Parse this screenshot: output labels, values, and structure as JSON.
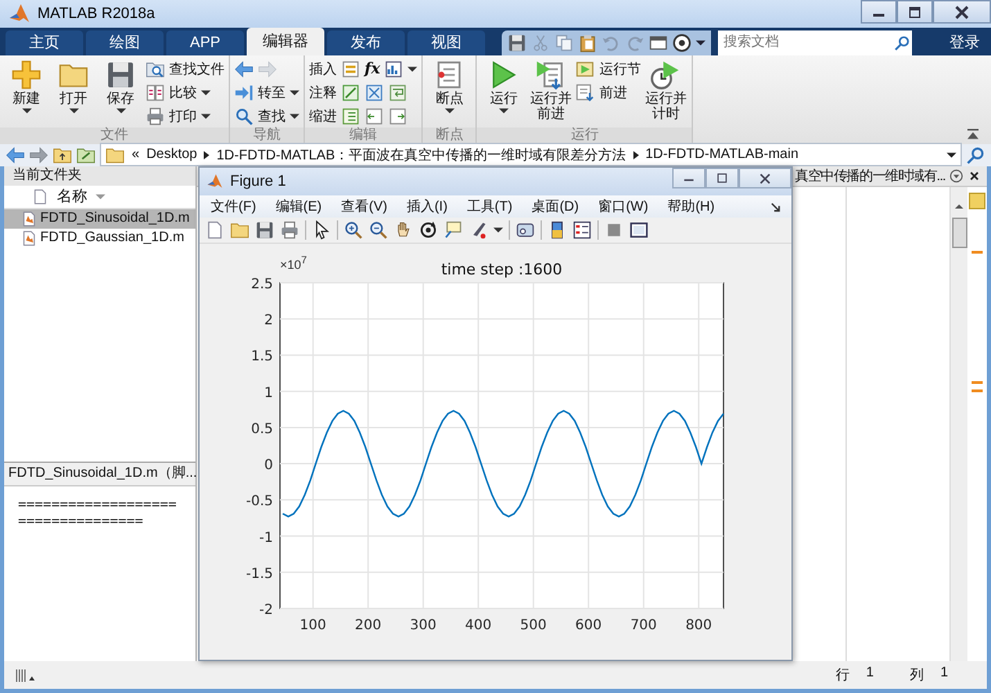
{
  "window": {
    "title": "MATLAB R2018a"
  },
  "tabs": [
    {
      "label": "主页",
      "selected": false
    },
    {
      "label": "绘图",
      "selected": false
    },
    {
      "label": "APP",
      "selected": false
    },
    {
      "label": "编辑器",
      "selected": true
    },
    {
      "label": "发布",
      "selected": false
    },
    {
      "label": "视图",
      "selected": false
    }
  ],
  "search": {
    "placeholder": "搜索文档"
  },
  "login": "登录",
  "ribbon": {
    "groups": [
      {
        "title": "文件",
        "columns": [
          {
            "kind": "large",
            "label": "新建",
            "dropdown": true
          },
          {
            "kind": "large",
            "label": "打开",
            "dropdown": true
          },
          {
            "kind": "large",
            "label": "保存",
            "dropdown": true
          },
          {
            "kind": "stack",
            "items": [
              {
                "kind": "button",
                "label": "查找文件",
                "dropdown": false
              },
              {
                "kind": "button",
                "label": "比较",
                "dropdown": true
              },
              {
                "kind": "button",
                "label": "打印",
                "dropdown": true
              }
            ]
          }
        ]
      },
      {
        "title": "导航",
        "columns": [
          {
            "kind": "stack",
            "items": [
              {
                "kind": "arrows"
              },
              {
                "kind": "button",
                "label": "转至",
                "dropdown": true
              },
              {
                "kind": "button",
                "label": "查找",
                "dropdown": true
              }
            ]
          }
        ]
      },
      {
        "title": "编辑",
        "columns": [
          {
            "kind": "stack",
            "items": [
              {
                "kind": "tools",
                "label": "插入",
                "glyph": "fx",
                "dropdown": true
              },
              {
                "kind": "tools",
                "label": "注释",
                "dropdown": false
              },
              {
                "kind": "tools",
                "label": "缩进",
                "dropdown": false
              }
            ]
          }
        ]
      },
      {
        "title": "断点",
        "columns": [
          {
            "kind": "large",
            "label": "断点",
            "dropdown": true
          }
        ]
      },
      {
        "title": "运行",
        "columns": [
          {
            "kind": "large",
            "label": "运行",
            "dropdown": true
          },
          {
            "kind": "large",
            "label": "运行并前进",
            "dropdown": false
          },
          {
            "kind": "stack",
            "items": [
              {
                "kind": "button",
                "label": "运行节",
                "dropdown": false
              },
              {
                "kind": "button",
                "label": "前进",
                "dropdown": false
              }
            ]
          },
          {
            "kind": "large",
            "label": "运行并计时",
            "dropdown": false
          }
        ]
      }
    ]
  },
  "address": {
    "overflow_marker": "«",
    "segments": [
      "Desktop",
      "1D-FDTD-MATLAB：平面波在真空中传播的一维时域有限差分方法",
      "1D-FDTD-MATLAB-main"
    ]
  },
  "file_browser": {
    "title": "当前文件夹",
    "column": "名称",
    "files": [
      {
        "name": "FDTD_Sinusoidal_1D.m",
        "selected": true
      },
      {
        "name": "FDTD_Gaussian_1D.m",
        "selected": false
      }
    ],
    "details_title": "FDTD_Sinusoidal_1D.m（脚...",
    "details_lines": [
      "===================",
      "==============="
    ]
  },
  "editor": {
    "tab_title": "真空中传播的一维时域有..."
  },
  "status_bar": {
    "row_label": "行",
    "row": "1",
    "col_label": "列",
    "col": "1"
  },
  "figure": {
    "title": "Figure 1",
    "menu": [
      "文件(F)",
      "编辑(E)",
      "查看(V)",
      "插入(I)",
      "工具(T)",
      "桌面(D)",
      "窗口(W)",
      "帮助(H)"
    ],
    "axis_multiplier": "×10$^{7}$",
    "chart_data": {
      "type": "line",
      "grid": true,
      "title": "time step :1600",
      "xlim": [
        40,
        845
      ],
      "ylim": [
        -2,
        2.5
      ],
      "xticks": [
        100,
        200,
        300,
        400,
        500,
        600,
        700,
        800
      ],
      "yticks": [
        -2,
        -1.5,
        -1,
        -0.5,
        0,
        0.5,
        1,
        1.5,
        2,
        2.5
      ],
      "x": [
        45,
        55,
        65,
        75,
        85,
        95,
        105,
        115,
        125,
        135,
        145,
        155,
        165,
        175,
        185,
        195,
        205,
        215,
        225,
        235,
        245,
        255,
        265,
        275,
        285,
        295,
        305,
        315,
        325,
        335,
        345,
        355,
        365,
        375,
        385,
        395,
        405,
        415,
        425,
        435,
        445,
        455,
        465,
        475,
        485,
        495,
        505,
        515,
        525,
        535,
        545,
        555,
        565,
        575,
        585,
        595,
        605,
        615,
        625,
        635,
        645,
        655,
        665,
        675,
        685,
        695,
        705,
        715,
        725,
        735,
        745,
        755,
        765,
        775,
        785,
        795,
        805,
        815,
        825,
        835,
        845
      ],
      "series": [
        {
          "color": "#0072bd",
          "values": [
            -0.69,
            -0.73,
            -0.69,
            -0.59,
            -0.43,
            -0.23,
            0,
            0.23,
            0.43,
            0.59,
            0.69,
            0.73,
            0.69,
            0.59,
            0.43,
            0.23,
            0,
            -0.23,
            -0.43,
            -0.59,
            -0.69,
            -0.73,
            -0.69,
            -0.59,
            -0.43,
            -0.23,
            0,
            0.23,
            0.43,
            0.59,
            0.69,
            0.73,
            0.69,
            0.59,
            0.43,
            0.23,
            0,
            -0.23,
            -0.43,
            -0.59,
            -0.69,
            -0.73,
            -0.69,
            -0.59,
            -0.43,
            -0.23,
            0,
            0.23,
            0.43,
            0.59,
            0.69,
            0.73,
            0.69,
            0.59,
            0.43,
            0.23,
            0,
            -0.23,
            -0.43,
            -0.59,
            -0.69,
            -0.73,
            -0.69,
            -0.59,
            -0.43,
            -0.23,
            0,
            0.23,
            0.43,
            0.59,
            0.69,
            0.73,
            0.69,
            0.59,
            0.43,
            0.23,
            0,
            0.23,
            0.43,
            0.59,
            0.69
          ]
        }
      ]
    }
  }
}
